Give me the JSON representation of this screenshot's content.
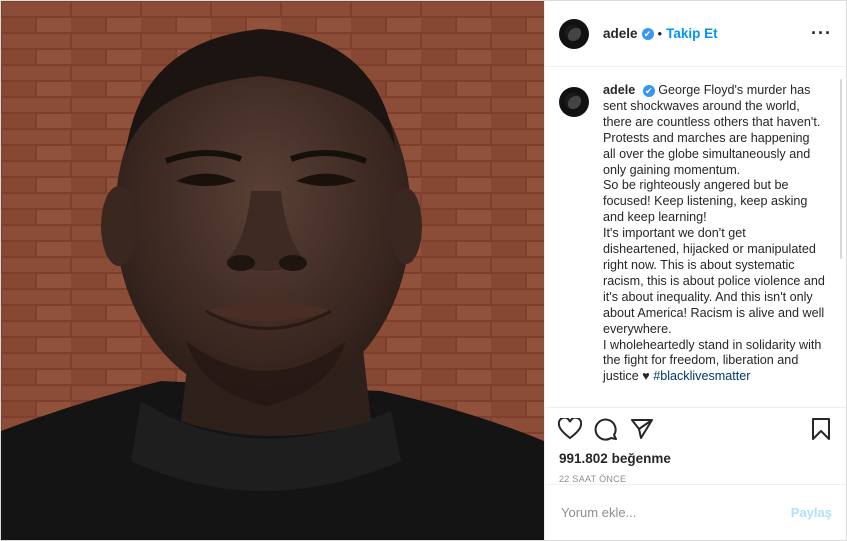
{
  "header": {
    "username": "adele",
    "verified_glyph": "✔",
    "separator": "•",
    "follow_label": "Takip Et",
    "more_label": "···"
  },
  "caption": {
    "username": "adele",
    "text": "George Floyd's murder has sent shockwaves around the world, there are countless others that haven't. Protests and marches are happening all over the globe simultaneously and only gaining momentum.",
    "para2": "So be righteously angered but be focused! Keep listening, keep asking and keep learning!",
    "para3": "It's important we don't get disheartened, hijacked or manipulated right now. This is about systematic racism, this is about police violence and it's about inequality. And this isn't only about America! Racism is alive and well everywhere.",
    "para4": "I wholeheartedly stand in solidarity with the fight for freedom, liberation and justice ♥",
    "hashtag": "#blacklivesmatter"
  },
  "actions": {
    "like_icon": "heart-icon",
    "comment_icon": "comment-icon",
    "share_icon": "paper-plane-icon",
    "save_icon": "bookmark-icon"
  },
  "likes": {
    "count": "991.802",
    "word": "beğenme"
  },
  "timestamp": "22 SAAT ÖNCE",
  "comment_box": {
    "placeholder": "Yorum ekle...",
    "post_label": "Paylaş"
  },
  "colors": {
    "accent": "#0095f6",
    "post_disabled": "#b2dffc",
    "verified": "#3897f0"
  }
}
